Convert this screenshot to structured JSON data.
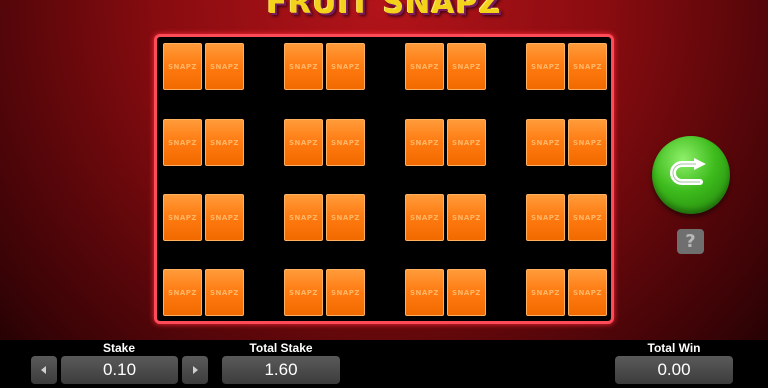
{
  "game": {
    "logo_text": "FRUIT SNAPZ",
    "card_label": "SNAPZ"
  },
  "controls": {
    "spin_icon": "u-turn-arrow-icon",
    "help_label": "?",
    "stake_label": "Stake",
    "stake_value": "0.10",
    "total_stake_label": "Total Stake",
    "total_stake_value": "1.60",
    "total_win_label": "Total Win",
    "total_win_value": "0.00"
  },
  "colors": {
    "board_border": "#ff4b57",
    "card": "#ff7a10",
    "spin_button": "#3dbb1c"
  }
}
